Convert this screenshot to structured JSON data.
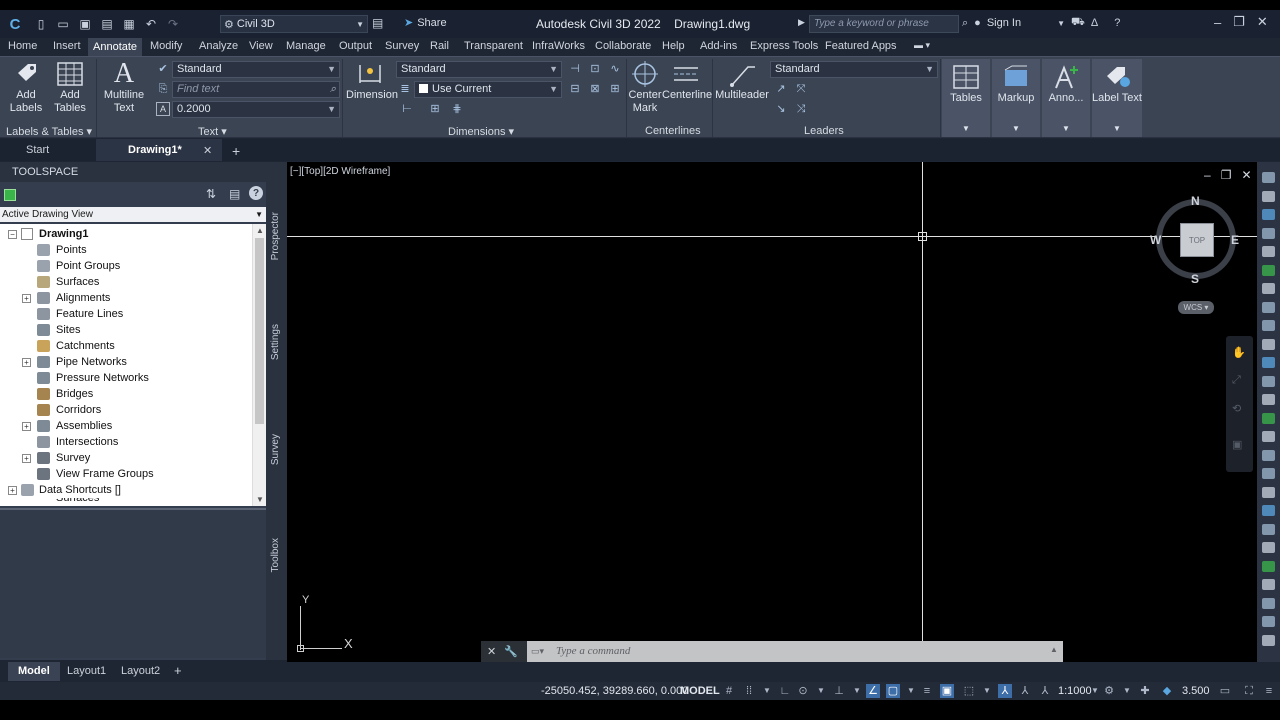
{
  "titlebar": {
    "workspace": "Civil 3D",
    "share": "Share",
    "app_title": "Autodesk Civil 3D 2022",
    "file_name": "Drawing1.dwg",
    "search_placeholder": "Type a keyword or phrase",
    "sign_in": "Sign In"
  },
  "ribbon_tabs": [
    "Home",
    "Insert",
    "Annotate",
    "Modify",
    "Analyze",
    "View",
    "Manage",
    "Output",
    "Survey",
    "Rail",
    "Transparent",
    "InfraWorks",
    "Collaborate",
    "Help",
    "Add-ins",
    "Express Tools",
    "Featured Apps"
  ],
  "active_tab": "Annotate",
  "ribbon": {
    "add_labels": "Add\nLabels",
    "add_tables": "Add\nTables",
    "labels_tables_panel": "Labels & Tables",
    "multiline_text": "Multiline\nText",
    "text_style": "Standard",
    "find_text_placeholder": "Find text",
    "text_height": "0.2000",
    "text_panel": "Text",
    "dimension": "Dimension",
    "dim_style": "Standard",
    "dim_layer": "Use Current",
    "dimensions_panel": "Dimensions",
    "center_mark": "Center\nMark",
    "centerline": "Centerline",
    "centerlines_panel": "Centerlines",
    "multileader": "Multileader",
    "leader_style": "Standard",
    "leaders_panel": "Leaders",
    "tables": "Tables",
    "markup": "Markup",
    "anno": "Anno...",
    "label_text": "Label Text"
  },
  "doc_tabs": {
    "start": "Start",
    "active": "Drawing1*"
  },
  "toolspace": {
    "title": "TOOLSPACE",
    "view": "Active Drawing View",
    "root": "Drawing1",
    "items": [
      {
        "label": "Points",
        "expand": false,
        "color": "#9aa3ad"
      },
      {
        "label": "Point Groups",
        "expand": false,
        "color": "#9aa3ad"
      },
      {
        "label": "Surfaces",
        "expand": false,
        "color": "#b7a77a"
      },
      {
        "label": "Alignments",
        "expand": true,
        "color": "#8c95a0"
      },
      {
        "label": "Feature Lines",
        "expand": false,
        "color": "#8c95a0"
      },
      {
        "label": "Sites",
        "expand": false,
        "color": "#7e8a96"
      },
      {
        "label": "Catchments",
        "expand": false,
        "color": "#c9a35a"
      },
      {
        "label": "Pipe Networks",
        "expand": true,
        "color": "#7e8a96"
      },
      {
        "label": "Pressure Networks",
        "expand": false,
        "color": "#7e8a96"
      },
      {
        "label": "Bridges",
        "expand": false,
        "color": "#a5844f"
      },
      {
        "label": "Corridors",
        "expand": false,
        "color": "#a5844f"
      },
      {
        "label": "Assemblies",
        "expand": true,
        "color": "#7e8a96"
      },
      {
        "label": "Intersections",
        "expand": false,
        "color": "#8c95a0"
      },
      {
        "label": "Survey",
        "expand": true,
        "color": "#6c7480"
      },
      {
        "label": "View Frame Groups",
        "expand": false,
        "color": "#6c7480"
      }
    ],
    "data_shortcuts": "Data Shortcuts []",
    "partial_item": "Surfaces",
    "vertical_tabs": [
      "Prospector",
      "Settings",
      "Survey",
      "Toolbox"
    ]
  },
  "viewport": {
    "label": "[−][Top][2D Wireframe]",
    "cube_face": "TOP",
    "compass": {
      "n": "N",
      "s": "S",
      "e": "E",
      "w": "W"
    },
    "wcs": "WCS",
    "ucs_x": "X",
    "ucs_y": "Y"
  },
  "command_line": {
    "placeholder": "Type a command"
  },
  "layout_tabs": [
    "Model",
    "Layout1",
    "Layout2"
  ],
  "status": {
    "coordinates": "-25050.452, 39289.660, 0.000",
    "space": "MODEL",
    "scale": "1:1000",
    "zoom": "3.500"
  }
}
